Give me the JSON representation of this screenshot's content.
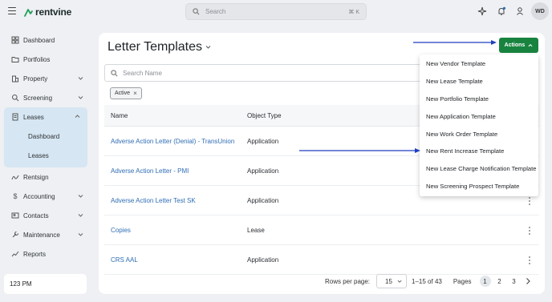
{
  "app": {
    "brand": "rentvine",
    "user_initials": "WD"
  },
  "search": {
    "placeholder": "Search",
    "shortcut": "⌘ K"
  },
  "sidebar": {
    "items": [
      {
        "label": "Dashboard",
        "icon": "dashboard-icon"
      },
      {
        "label": "Portfolios",
        "icon": "folder-icon"
      },
      {
        "label": "Property",
        "icon": "building-icon",
        "has_children": true
      },
      {
        "label": "Screening",
        "icon": "screening-icon",
        "has_children": true
      },
      {
        "label": "Leases",
        "icon": "document-icon",
        "expanded": true,
        "children": [
          {
            "label": "Dashboard"
          },
          {
            "label": "Leases"
          }
        ]
      },
      {
        "label": "Rentsign",
        "icon": "signature-icon"
      },
      {
        "label": "Accounting",
        "icon": "dollar-icon",
        "has_children": true
      },
      {
        "label": "Contacts",
        "icon": "contacts-icon",
        "has_children": true
      },
      {
        "label": "Maintenance",
        "icon": "wrench-icon",
        "has_children": true
      },
      {
        "label": "Reports",
        "icon": "reports-icon"
      }
    ],
    "footer_text": "123 PM"
  },
  "main": {
    "title": "Letter Templates",
    "search_placeholder": "Search Name",
    "filter_chip": "Active",
    "columns": {
      "name": "Name",
      "type": "Object Type"
    },
    "rows": [
      {
        "name": "Adverse Action Letter (Denial) - TransUnion",
        "type": "Application"
      },
      {
        "name": "Adverse Action Letter - PMI",
        "type": "Application"
      },
      {
        "name": "Adverse Action Letter Test SK",
        "type": "Application"
      },
      {
        "name": "Copies",
        "type": "Lease"
      },
      {
        "name": "CRS AAL",
        "type": "Application"
      }
    ],
    "pagination": {
      "rows_per_page_label": "Rows per page:",
      "rows_per_page": "15",
      "range": "1–15 of 43",
      "pages_label": "Pages",
      "pages": [
        "1",
        "2",
        "3"
      ],
      "current_page": "1"
    }
  },
  "actions": {
    "button_label": "Actions",
    "menu": [
      "New Vendor Template",
      "New Lease Template",
      "New Portfolio Template",
      "New Application Template",
      "New Work Order Template",
      "New Rent Increase Template",
      "New Lease Charge Notification Template",
      "New Screening Prospect Template"
    ]
  },
  "colors": {
    "accent_green": "#18833f",
    "link_blue": "#2f6db5",
    "active_nav_bg": "#d6e6f2",
    "annotation_arrow": "#1f3fbf"
  }
}
